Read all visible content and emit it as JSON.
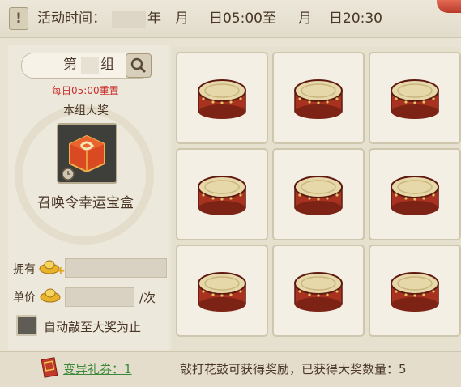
{
  "header": {
    "label": "活动时间：",
    "year_suffix": "年",
    "month1_suffix": "月",
    "day1_time": "日05:00",
    "to_word": "至",
    "month2_suffix": "月",
    "day2_time": "日20:30"
  },
  "group": {
    "prefix": "第",
    "suffix": "组"
  },
  "reset_notice": "每日05:00重置",
  "prize": {
    "title": "本组大奖",
    "name": "召唤令幸运宝盒"
  },
  "own_label": "拥有",
  "price_label": "单价",
  "per_unit": "/次",
  "auto_label": "自动敲至大奖为止",
  "coupon_label": "变异礼券：1",
  "footer_text": "敲打花鼓可获得奖励，已获得大奖数量：5",
  "colors": {
    "accent_red": "#c9302c",
    "coupon_green": "#3a8a3a",
    "drum_red": "#a8321f",
    "drum_head": "#e7d8a9"
  },
  "icons": [
    "warning-icon",
    "search-icon",
    "gold-ingot-icon",
    "gold-ingot-plus-icon",
    "coupon-icon",
    "clock-icon",
    "drum-icon"
  ]
}
